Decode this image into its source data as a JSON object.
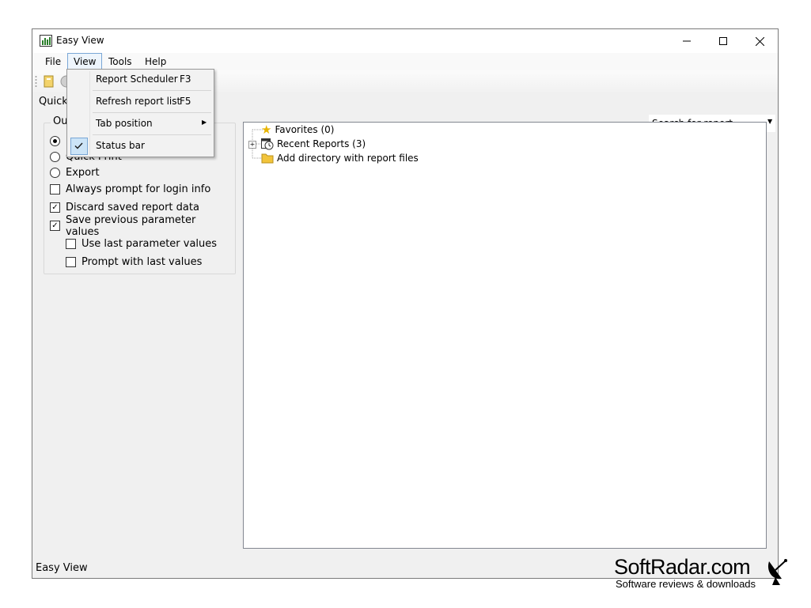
{
  "window": {
    "title": "Easy View"
  },
  "menubar": {
    "items": [
      "File",
      "View",
      "Tools",
      "Help"
    ]
  },
  "view_menu": {
    "items": [
      {
        "label": "Report Scheduler",
        "shortcut": "F3"
      },
      {
        "label": "Refresh report list",
        "shortcut": "F5"
      },
      {
        "label": "Tab position",
        "shortcut": ""
      },
      {
        "label": "Status bar",
        "shortcut": "",
        "checked": true
      }
    ]
  },
  "search": {
    "placeholder": "Search for report"
  },
  "tab": {
    "label": "Quick"
  },
  "output_group": {
    "title": "Out",
    "radios": [
      {
        "label": "",
        "checked": true
      },
      {
        "label": "Quick Print",
        "checked": false
      },
      {
        "label": "Export",
        "checked": false
      }
    ],
    "checkboxes": [
      {
        "label": "Always prompt for login info",
        "checked": false
      },
      {
        "label": "Discard saved report data",
        "checked": true
      },
      {
        "label": "Save previous parameter values",
        "checked": true
      },
      {
        "label": "Use last parameter values",
        "checked": false
      },
      {
        "label": "Prompt with last values",
        "checked": false
      }
    ]
  },
  "tree": {
    "items": [
      {
        "label": "Favorites (0)",
        "icon": "star-icon"
      },
      {
        "label": "Recent Reports (3)",
        "icon": "recent-reports-icon"
      },
      {
        "label": "Add directory with report files",
        "icon": "folder-icon"
      }
    ]
  },
  "statusbar": {
    "text": "Easy View"
  },
  "watermark": {
    "title": "SoftRadar.com",
    "subtitle": "Software reviews & downloads"
  }
}
